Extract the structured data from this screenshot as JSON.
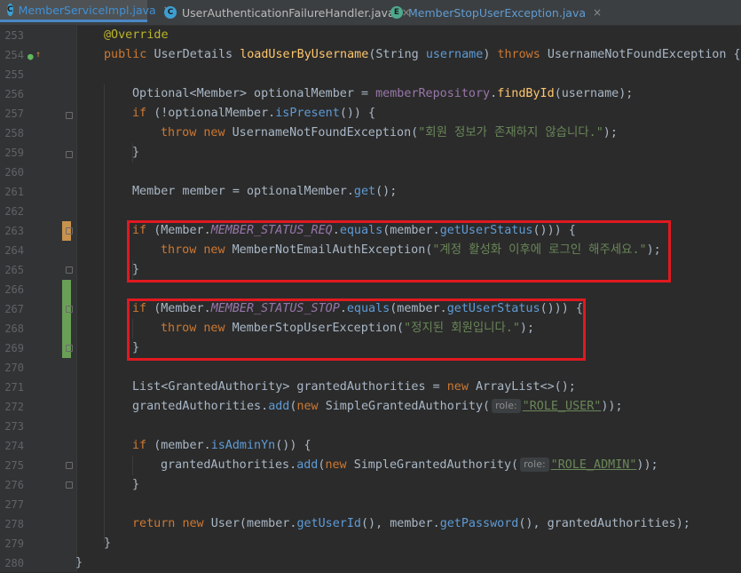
{
  "tabs": [
    {
      "icon": "C",
      "label": "MemberServiceImpl.java",
      "close": "×"
    },
    {
      "icon": "C",
      "label": "UserAuthenticationFailureHandler.java",
      "close": "×"
    },
    {
      "icon": "E",
      "label": "MemberStopUserException.java",
      "close": "×"
    }
  ],
  "line_numbers": [
    "253",
    "254",
    "255",
    "256",
    "257",
    "258",
    "259",
    "260",
    "261",
    "262",
    "263",
    "264",
    "265",
    "266",
    "267",
    "268",
    "269",
    "270",
    "271",
    "272",
    "273",
    "274",
    "275",
    "276",
    "277",
    "278",
    "279",
    "280"
  ],
  "code": {
    "l253": {
      "anno": "@Override"
    },
    "l254": {
      "kw_public": "public ",
      "type": "UserDetails ",
      "method": "loadUserByUsername",
      "p1": "(String ",
      "param": "username",
      "p2": ") ",
      "kw_throws": "throws ",
      "exc": "UsernameNotFoundException {"
    },
    "l256": {
      "type": "Optional",
      "lt": "<",
      "gen": "Member",
      "rest": "> optionalMember = ",
      "field": "memberRepository",
      "dot": ".",
      "call": "findById",
      "args": "(username);"
    },
    "l257": {
      "kw_if": "if ",
      "p1": "(!optionalMember.",
      "call": "isPresent",
      "p2": "()) {"
    },
    "l258": {
      "kw_throw": "throw ",
      "kw_new": "new ",
      "cls": "UsernameNotFoundException(",
      "str": "\"회원 정보가 존재하지 않습니다.\"",
      "end": ");"
    },
    "l259": {
      "brace": "}"
    },
    "l261": {
      "t": "Member member = optionalMember.",
      "call": "get",
      "end": "();"
    },
    "l263": {
      "kw_if": "if ",
      "p1": "(Member.",
      "const": "MEMBER_STATUS_REQ",
      "dot": ".",
      "call1": "equals",
      "p2": "(member.",
      "call2": "getUserStatus",
      "p3": "())) {"
    },
    "l264": {
      "kw_throw": "throw ",
      "kw_new": "new ",
      "cls": "MemberNotEmailAuthException(",
      "str": "\"계정 활성화 이후에 로그인 해주세요.\"",
      "end": ");"
    },
    "l265": {
      "brace": "}"
    },
    "l267": {
      "kw_if": "if ",
      "p1": "(Member.",
      "const": "MEMBER_STATUS_STOP",
      "dot": ".",
      "call1": "equals",
      "p2": "(member.",
      "call2": "getUserStatus",
      "p3": "())) {"
    },
    "l268": {
      "kw_throw": "throw ",
      "kw_new": "new ",
      "cls": "MemberStopUserException(",
      "str": "\"정지된 회원입니다.\"",
      "end": ");"
    },
    "l269": {
      "brace": "}"
    },
    "l271": {
      "type": "List",
      "lt": "<",
      "gen": "GrantedAuthority",
      "rest": "> grantedAuthorities = ",
      "kw_new": "new ",
      "cls": "ArrayList<>();"
    },
    "l272": {
      "t": "grantedAuthorities.",
      "call": "add",
      "p1": "(",
      "kw_new": "new ",
      "cls": "SimpleGrantedAuthority(",
      "hint": "role:",
      "str": "\"ROLE_USER\"",
      "end": "));"
    },
    "l274": {
      "kw_if": "if ",
      "p1": "(member.",
      "call": "isAdminYn",
      "p2": "()) {"
    },
    "l275": {
      "t": "grantedAuthorities.",
      "call": "add",
      "p1": "(",
      "kw_new": "new ",
      "cls": "SimpleGrantedAuthority(",
      "hint": "role:",
      "str": "\"ROLE_ADMIN\"",
      "end": "));"
    },
    "l276": {
      "brace": "}"
    },
    "l278": {
      "kw_return": "return ",
      "kw_new": "new ",
      "cls": "User(member.",
      "call1": "getUserId",
      "p1": "(), member.",
      "call2": "getPassword",
      "p2": "(), grantedAuthorities);"
    },
    "l279": {
      "brace": "}"
    },
    "l280": {
      "brace": "}"
    }
  },
  "colors": {
    "highlight_box": "#e0191f",
    "keyword": "#cc7832",
    "string": "#6a8759",
    "method": "#ffc66d",
    "constant": "#9876aa",
    "background": "#2b2b2b"
  }
}
